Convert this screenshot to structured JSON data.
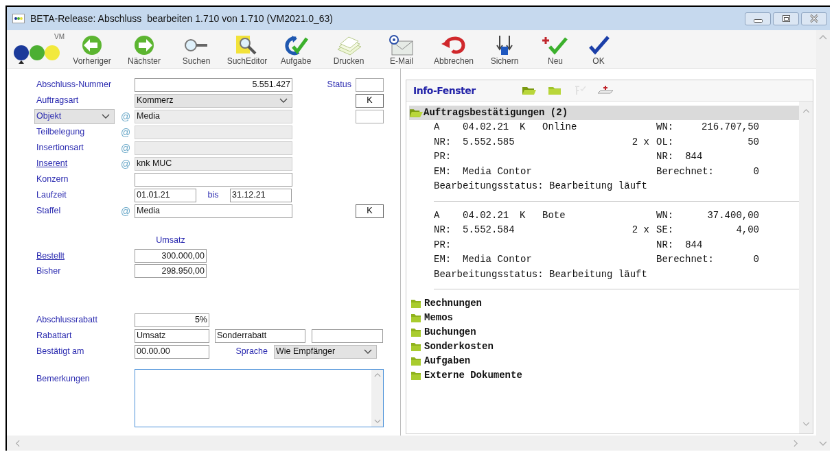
{
  "window": {
    "title": "BETA-Release: Abschluss  bearbeiten 1.710 von 1.710 (VM2021.0_63)"
  },
  "logo": {
    "text": "VM"
  },
  "toolbar": [
    {
      "label": "Vorheriger"
    },
    {
      "label": "Nächster"
    },
    {
      "label": "Suchen"
    },
    {
      "label": "SuchEditor"
    },
    {
      "label": "Aufgabe"
    },
    {
      "label": "Drucken"
    },
    {
      "label": "E-Mail"
    },
    {
      "label": "Abbrechen"
    },
    {
      "label": "Sichern"
    },
    {
      "label": "Neu"
    },
    {
      "label": "OK"
    }
  ],
  "form": {
    "rows": [
      {
        "label": "Abschluss-Nummer",
        "kind": "text",
        "field": {
          "kind": "number",
          "value": "5.551.427"
        },
        "side": {
          "label": "Status"
        }
      },
      {
        "label": "Auftragsart",
        "kind": "text",
        "field": {
          "kind": "dropdown",
          "value": "Kommerz"
        },
        "side": {
          "value": "K"
        }
      },
      {
        "label": "Objekt",
        "kind": "dropdown",
        "marker": "@",
        "field": {
          "kind": "readonly",
          "value": "Media"
        },
        "side": {}
      },
      {
        "label": "Teilbelegung",
        "kind": "text",
        "marker": "@",
        "field": {
          "kind": "readonly"
        }
      },
      {
        "label": "Insertionsart",
        "kind": "text",
        "marker": "@",
        "field": {
          "kind": "readonly"
        }
      },
      {
        "label": "Inserent",
        "kind": "link",
        "marker": "@",
        "field": {
          "kind": "readonly",
          "value": "knk MUC"
        }
      },
      {
        "label": "Konzern",
        "kind": "text",
        "field": {
          "kind": "text"
        }
      },
      {
        "label": "Laufzeit",
        "kind": "text",
        "field": {
          "kind": "range",
          "value": "01.01.21",
          "to_label": "bis",
          "to_value": "31.12.21"
        }
      },
      {
        "label": "Staffel",
        "kind": "text",
        "marker": "@",
        "field": {
          "kind": "text",
          "value": "Media"
        },
        "side": {
          "value": "K"
        }
      }
    ],
    "revenue": {
      "heading": "Umsatz",
      "rows": [
        {
          "label": "Bestellt",
          "kind": "link",
          "value": "300.000,00"
        },
        {
          "label": "Bisher",
          "kind": "text",
          "value": "298.950,00"
        }
      ]
    },
    "discount": [
      {
        "label": "Abschlussrabatt",
        "fields": [
          {
            "kind": "number",
            "value": "5%"
          }
        ]
      },
      {
        "label": "Rabattart",
        "fields": [
          {
            "kind": "text",
            "value": "Umsatz"
          },
          {
            "kind": "text",
            "value": "Sonderrabatt"
          },
          {
            "kind": "text"
          }
        ]
      },
      {
        "label": "Bestätigt am",
        "fields": [
          {
            "kind": "text",
            "value": "00.00.00"
          },
          {
            "kind": "dropdown",
            "label": "Sprache",
            "value": "Wie Empfänger"
          }
        ]
      }
    ],
    "remarks": {
      "label": "Bemerkungen"
    }
  },
  "info_panel": {
    "title": "Info-Fenster",
    "tools": [
      {
        "disabled": false
      },
      {
        "disabled": false
      },
      {
        "disabled": true
      },
      {
        "disabled": false
      }
    ],
    "groups": [
      {
        "label": "Auftragsbestätigungen (2)",
        "expanded": true,
        "selected": true,
        "entries": [
          {
            "letter": "A",
            "date": "04.02.21",
            "code": "K",
            "medium": "Online",
            "nr_label": "NR:",
            "nr": "5.552.585",
            "count": "2 x",
            "pr_label": "PR:",
            "em_label": "EM:",
            "em": "Media Contor",
            "status": "Bearbeitungsstatus: Bearbeitung läuft",
            "right": [
              {
                "kind": "amount",
                "label": "WN:",
                "value": "216.707,50"
              },
              {
                "kind": "amount",
                "label": "OL:",
                "value": "50"
              },
              {
                "kind": "ref",
                "label": "NR:",
                "value": "844"
              },
              {
                "kind": "amount",
                "label": "Berechnet:",
                "value": "0"
              }
            ]
          },
          {
            "letter": "A",
            "date": "04.02.21",
            "code": "K",
            "medium": "Bote",
            "nr_label": "NR:",
            "nr": "5.552.584",
            "count": "2 x",
            "pr_label": "PR:",
            "em_label": "EM:",
            "em": "Media Contor",
            "status": "Bearbeitungsstatus: Bearbeitung läuft",
            "right": [
              {
                "kind": "amount",
                "label": "WN:",
                "value": "37.400,00"
              },
              {
                "kind": "amount",
                "label": "SE:",
                "value": "4,00"
              },
              {
                "kind": "ref",
                "label": "NR:",
                "value": "844"
              },
              {
                "kind": "amount",
                "label": "Berechnet:",
                "value": "0"
              }
            ]
          }
        ]
      },
      {
        "label": "Rechnungen",
        "expanded": false,
        "selected": false
      },
      {
        "label": "Memos",
        "expanded": false,
        "selected": false
      },
      {
        "label": "Buchungen",
        "expanded": false,
        "selected": false
      },
      {
        "label": "Sonderkosten",
        "expanded": false,
        "selected": false
      },
      {
        "label": "Aufgaben",
        "expanded": false,
        "selected": false
      },
      {
        "label": "Externe Dokumente",
        "expanded": false,
        "selected": false
      }
    ]
  }
}
